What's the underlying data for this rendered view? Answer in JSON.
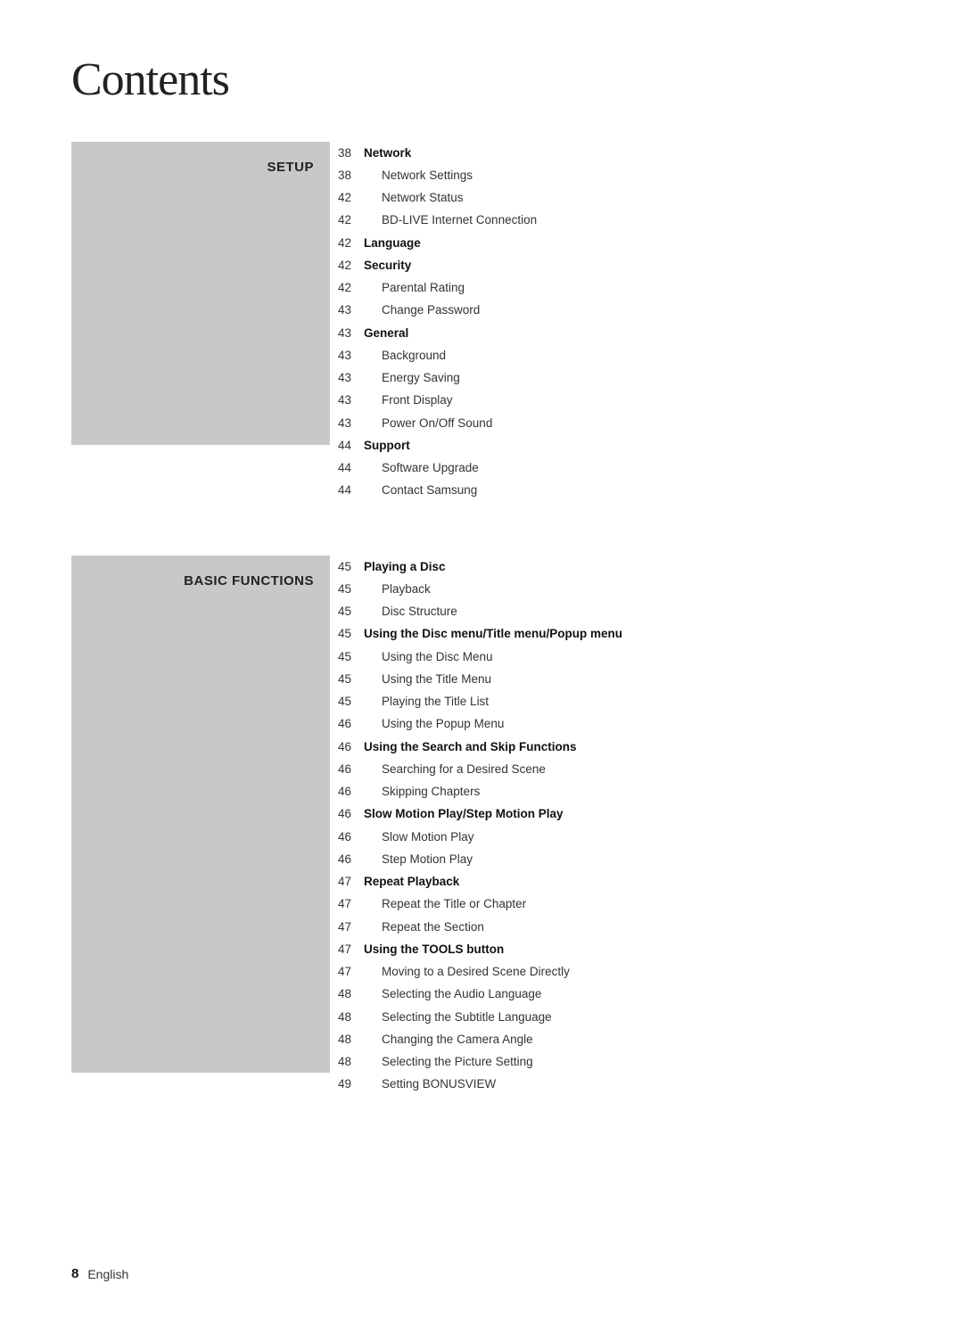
{
  "page": {
    "title": "Contents",
    "footer": {
      "page_number": "8",
      "language": "English"
    }
  },
  "sections": [
    {
      "id": "setup",
      "label": "SETUP",
      "entries": [
        {
          "number": "38",
          "text": "Network",
          "bold": true,
          "indented": false
        },
        {
          "number": "38",
          "text": "Network Settings",
          "bold": false,
          "indented": true
        },
        {
          "number": "42",
          "text": "Network Status",
          "bold": false,
          "indented": true
        },
        {
          "number": "42",
          "text": "BD-LIVE Internet Connection",
          "bold": false,
          "indented": true
        },
        {
          "number": "42",
          "text": "Language",
          "bold": true,
          "indented": false
        },
        {
          "number": "42",
          "text": "Security",
          "bold": true,
          "indented": false
        },
        {
          "number": "42",
          "text": "Parental Rating",
          "bold": false,
          "indented": true
        },
        {
          "number": "43",
          "text": "Change Password",
          "bold": false,
          "indented": true
        },
        {
          "number": "43",
          "text": "General",
          "bold": true,
          "indented": false
        },
        {
          "number": "43",
          "text": "Background",
          "bold": false,
          "indented": true
        },
        {
          "number": "43",
          "text": "Energy Saving",
          "bold": false,
          "indented": true
        },
        {
          "number": "43",
          "text": "Front Display",
          "bold": false,
          "indented": true
        },
        {
          "number": "43",
          "text": "Power On/Off Sound",
          "bold": false,
          "indented": true
        },
        {
          "number": "44",
          "text": "Support",
          "bold": true,
          "indented": false
        },
        {
          "number": "44",
          "text": "Software Upgrade",
          "bold": false,
          "indented": true
        },
        {
          "number": "44",
          "text": "Contact Samsung",
          "bold": false,
          "indented": true
        }
      ]
    },
    {
      "id": "basic-functions",
      "label": "BASIC FUNCTIONS",
      "entries": [
        {
          "number": "45",
          "text": "Playing a Disc",
          "bold": true,
          "indented": false
        },
        {
          "number": "45",
          "text": "Playback",
          "bold": false,
          "indented": true
        },
        {
          "number": "45",
          "text": "Disc Structure",
          "bold": false,
          "indented": true
        },
        {
          "number": "45",
          "text": "Using the Disc menu/Title menu/Popup menu",
          "bold": true,
          "indented": false
        },
        {
          "number": "45",
          "text": "Using the Disc Menu",
          "bold": false,
          "indented": true
        },
        {
          "number": "45",
          "text": "Using the Title Menu",
          "bold": false,
          "indented": true
        },
        {
          "number": "45",
          "text": "Playing the Title List",
          "bold": false,
          "indented": true
        },
        {
          "number": "46",
          "text": "Using the Popup Menu",
          "bold": false,
          "indented": true
        },
        {
          "number": "46",
          "text": "Using the Search and Skip Functions",
          "bold": true,
          "indented": false
        },
        {
          "number": "46",
          "text": "Searching for a Desired Scene",
          "bold": false,
          "indented": true
        },
        {
          "number": "46",
          "text": "Skipping Chapters",
          "bold": false,
          "indented": true
        },
        {
          "number": "46",
          "text": "Slow Motion Play/Step Motion Play",
          "bold": true,
          "indented": false
        },
        {
          "number": "46",
          "text": "Slow Motion Play",
          "bold": false,
          "indented": true
        },
        {
          "number": "46",
          "text": "Step Motion Play",
          "bold": false,
          "indented": true
        },
        {
          "number": "47",
          "text": "Repeat Playback",
          "bold": true,
          "indented": false
        },
        {
          "number": "47",
          "text": "Repeat the Title or Chapter",
          "bold": false,
          "indented": true
        },
        {
          "number": "47",
          "text": "Repeat the Section",
          "bold": false,
          "indented": true
        },
        {
          "number": "47",
          "text": "Using the TOOLS button",
          "bold": true,
          "indented": false
        },
        {
          "number": "47",
          "text": "Moving to a Desired Scene Directly",
          "bold": false,
          "indented": true
        },
        {
          "number": "48",
          "text": "Selecting the Audio Language",
          "bold": false,
          "indented": true
        },
        {
          "number": "48",
          "text": "Selecting the Subtitle Language",
          "bold": false,
          "indented": true
        },
        {
          "number": "48",
          "text": "Changing the Camera Angle",
          "bold": false,
          "indented": true
        },
        {
          "number": "48",
          "text": "Selecting the Picture Setting",
          "bold": false,
          "indented": true
        },
        {
          "number": "49",
          "text": "Setting BONUSVIEW",
          "bold": false,
          "indented": true
        }
      ]
    }
  ]
}
